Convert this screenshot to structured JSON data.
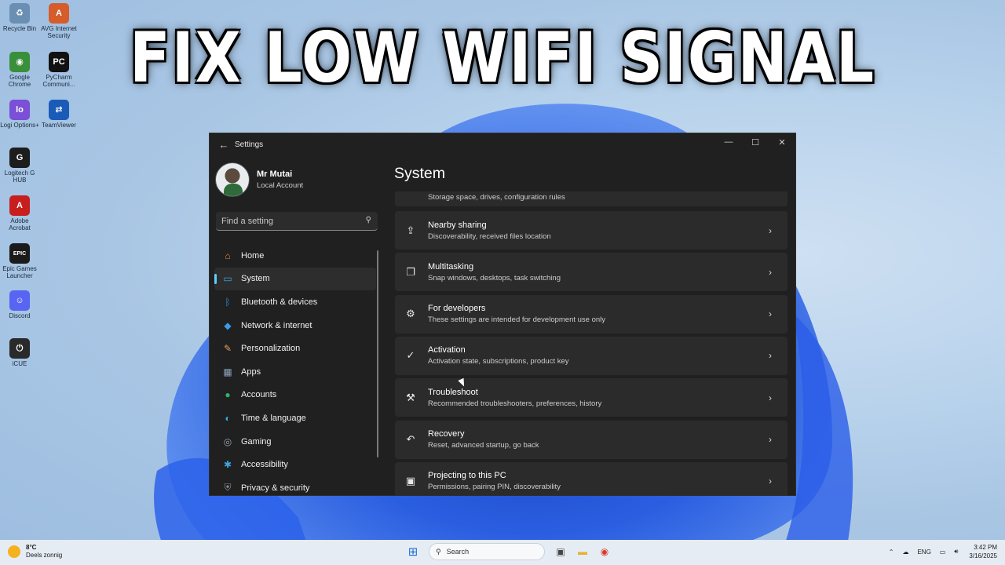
{
  "headline": "FIX LOW WIFI SIGNAL",
  "desktop_icons": [
    {
      "label": "Recycle Bin",
      "icon": "recycle-bin-icon",
      "color": "#6a8fb3"
    },
    {
      "label": "AVG Internet Security",
      "icon": "avg-icon",
      "color": "#d65c2a"
    },
    {
      "label": "Google Chrome",
      "icon": "chrome-icon",
      "color": "#3a8f3a"
    },
    {
      "label": "PyCharm Communi...",
      "icon": "pycharm-icon",
      "color": "#111111"
    },
    {
      "label": "Logi Options+",
      "icon": "logi-icon",
      "color": "#7b4fd6"
    },
    {
      "label": "TeamViewer",
      "icon": "teamviewer-icon",
      "color": "#1a5bb8"
    },
    {
      "label": "Logitech G HUB",
      "icon": "ghub-icon",
      "color": "#1d1d1d"
    },
    {
      "label": "Adobe Acrobat",
      "icon": "acrobat-icon",
      "color": "#c81e1e"
    },
    {
      "label": "Epic Games Launcher",
      "icon": "epic-icon",
      "color": "#1b1b1b"
    },
    {
      "label": "Discord",
      "icon": "discord-icon",
      "color": "#5865f2"
    },
    {
      "label": "iCUE",
      "icon": "icue-icon",
      "color": "#2a2a2a"
    }
  ],
  "window": {
    "title": "Settings",
    "minimize": "—",
    "maximize": "☐",
    "close": "✕"
  },
  "profile": {
    "name": "Mr Mutai",
    "account": "Local Account"
  },
  "search": {
    "placeholder": "Find a setting"
  },
  "nav": [
    {
      "label": "Home",
      "icon": "home-icon",
      "color": "#e08a3c",
      "active": false
    },
    {
      "label": "System",
      "icon": "system-icon",
      "color": "#3aa7e0",
      "active": true
    },
    {
      "label": "Bluetooth & devices",
      "icon": "bluetooth-icon",
      "color": "#2f8de0",
      "active": false
    },
    {
      "label": "Network & internet",
      "icon": "network-icon",
      "color": "#3b9be8",
      "active": false
    },
    {
      "label": "Personalization",
      "icon": "brush-icon",
      "color": "#e0a060",
      "active": false
    },
    {
      "label": "Apps",
      "icon": "apps-icon",
      "color": "#8aa0b8",
      "active": false
    },
    {
      "label": "Accounts",
      "icon": "accounts-icon",
      "color": "#2fb36a",
      "active": false
    },
    {
      "label": "Time & language",
      "icon": "globe-icon",
      "color": "#3aa7e0",
      "active": false
    },
    {
      "label": "Gaming",
      "icon": "gaming-icon",
      "color": "#9aa4ae",
      "active": false
    },
    {
      "label": "Accessibility",
      "icon": "accessibility-icon",
      "color": "#3aa7e0",
      "active": false
    },
    {
      "label": "Privacy & security",
      "icon": "shield-icon",
      "color": "#8d96a0",
      "active": false
    }
  ],
  "main": {
    "title": "System",
    "cards": [
      {
        "title": "",
        "subtitle": "Storage space, drives, configuration rules",
        "icon": "storage-icon"
      },
      {
        "title": "Nearby sharing",
        "subtitle": "Discoverability, received files location",
        "icon": "share-icon"
      },
      {
        "title": "Multitasking",
        "subtitle": "Snap windows, desktops, task switching",
        "icon": "multitask-icon"
      },
      {
        "title": "For developers",
        "subtitle": "These settings are intended for development use only",
        "icon": "developer-icon"
      },
      {
        "title": "Activation",
        "subtitle": "Activation state, subscriptions, product key",
        "icon": "activation-icon"
      },
      {
        "title": "Troubleshoot",
        "subtitle": "Recommended troubleshooters, preferences, history",
        "icon": "wrench-icon"
      },
      {
        "title": "Recovery",
        "subtitle": "Reset, advanced startup, go back",
        "icon": "recovery-icon"
      },
      {
        "title": "Projecting to this PC",
        "subtitle": "Permissions, pairing PIN, discoverability",
        "icon": "projecting-icon"
      }
    ]
  },
  "taskbar": {
    "weather_temp": "8°C",
    "weather_desc": "Deels zonnig",
    "search_label": "Search",
    "lang": "ENG",
    "time": "3:42 PM",
    "date": "3/16/2025"
  }
}
